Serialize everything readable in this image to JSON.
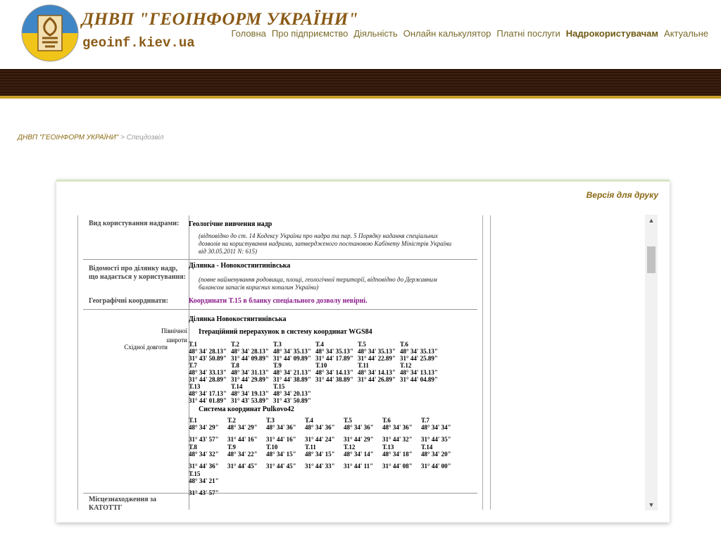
{
  "header": {
    "title": "ДНВП \"ГЕОІНФОРМ УКРАЇНИ\"",
    "url": "geoinf.kiev.ua",
    "nav": [
      "Головна",
      "Про підприємство",
      "Діяльність",
      "Онлайн калькулятор",
      "Платні послуги",
      "Надрокористувачам",
      "Актуальне"
    ],
    "active_nav": "Надрокористувачам",
    "colors": {
      "brand": "#8a5a16",
      "band": "#2a1508",
      "accent": "#c9a028"
    }
  },
  "breadcrumb": {
    "home": "ДНВП \"ГЕОІНФОРМ УКРАЇНИ\"",
    "separator": ">",
    "current": "Спецдозвіл"
  },
  "print_label": "Версія для друку",
  "doc": {
    "use_label": "Вид користування надрами:",
    "use_value": "Геологічне вивчення надр",
    "use_note": "(відповідно до ст. 14 Кодексу України про надра та пар. 5 Порядку надання спеціальних дозволів на користування надрами, затвердженого постановою Кабінету Міністрів України від 30.05.2011 N: 615)",
    "site_label": "Відомості про ділянку надр, що надається у користування:",
    "site_value": "Ділянка - Новокостянтинівська",
    "site_note": "(повне найменування родовища, площі, геологічної території, відповідно до Державним балансом запасів корисних копалин України)",
    "geo_label": "Географічні координати:",
    "warning": "Координати Т.15 в бланку спеціального дозволу невірні.",
    "lat_label": "Північної широти",
    "lon_label": "Східної довготи",
    "site_title": "Ділянка Новокостянтинівська",
    "wgs_title": "Ітераційний перерахунок в систему координат WGS84",
    "wgs_points": [
      [
        "Т.1",
        "48° 34' 28.13\"",
        "31° 43' 50.89\""
      ],
      [
        "Т.2",
        "48° 34' 28.13\"",
        "31° 44' 09.89\""
      ],
      [
        "Т.3",
        "48° 34' 35.13\"",
        "31° 44' 09.89\""
      ],
      [
        "Т.4",
        "48° 34' 35.13\"",
        "31° 44' 17.89\""
      ],
      [
        "Т.5",
        "48° 34' 35.13\"",
        "31° 44' 22.89\""
      ],
      [
        "Т.6",
        "48° 34' 35.13\"",
        "31° 44' 25.89\""
      ],
      [
        "Т.7",
        "48° 34' 33.13\"",
        "31° 44' 28.89\""
      ],
      [
        "Т.8",
        "48° 34' 31.13\"",
        "31° 44' 29.89\""
      ],
      [
        "Т.9",
        "48° 34' 21.13\"",
        "31° 44' 38.89\""
      ],
      [
        "Т.10",
        "48° 34' 14.13\"",
        "31° 44' 38.89\""
      ],
      [
        "Т.11",
        "48° 34' 14.13\"",
        "31° 44' 26.89\""
      ],
      [
        "Т.12",
        "48° 34' 13.13\"",
        "31° 44' 04.89\""
      ],
      [
        "Т.13",
        "48° 34' 17.13\"",
        "31° 44' 01.89\""
      ],
      [
        "Т.14",
        "48° 34' 19.13\"",
        "31° 43' 53.89\""
      ],
      [
        "Т.15",
        "48° 34' 20.13\"",
        "31° 43' 50.89\""
      ]
    ],
    "pulkovo_title": "Система координат Pulkovo42",
    "pulkovo_points": [
      [
        "Т.1",
        "48° 34' 29\"",
        "31° 43' 57\""
      ],
      [
        "Т.2",
        "48° 34' 29\"",
        "31° 44' 16\""
      ],
      [
        "Т.3",
        "48° 34' 36\"",
        "31° 44' 16\""
      ],
      [
        "Т.4",
        "48° 34' 36\"",
        "31° 44' 24\""
      ],
      [
        "Т.5",
        "48° 34' 36\"",
        "31° 44' 29\""
      ],
      [
        "Т.6",
        "48° 34' 36\"",
        "31° 44' 32\""
      ],
      [
        "Т.7",
        "48° 34' 34\"",
        "31° 44' 35\""
      ],
      [
        "Т.8",
        "48° 34' 32\"",
        "31° 44' 36\""
      ],
      [
        "Т.9",
        "48° 34' 22\"",
        "31° 44' 45\""
      ],
      [
        "Т.10",
        "48° 34' 15\"",
        "31° 44' 45\""
      ],
      [
        "Т.11",
        "48° 34' 15\"",
        "31° 44' 33\""
      ],
      [
        "Т.12",
        "48° 34' 14\"",
        "31° 44' 11\""
      ],
      [
        "Т.13",
        "48° 34' 18\"",
        "31° 44' 08\""
      ],
      [
        "Т.14",
        "48° 34' 20\"",
        "31° 44' 00\""
      ],
      [
        "Т.15",
        "48° 34' 21\"",
        "31° 43' 57\""
      ]
    ],
    "location_label": "Місцезнаходження за КАТОТТГ"
  }
}
